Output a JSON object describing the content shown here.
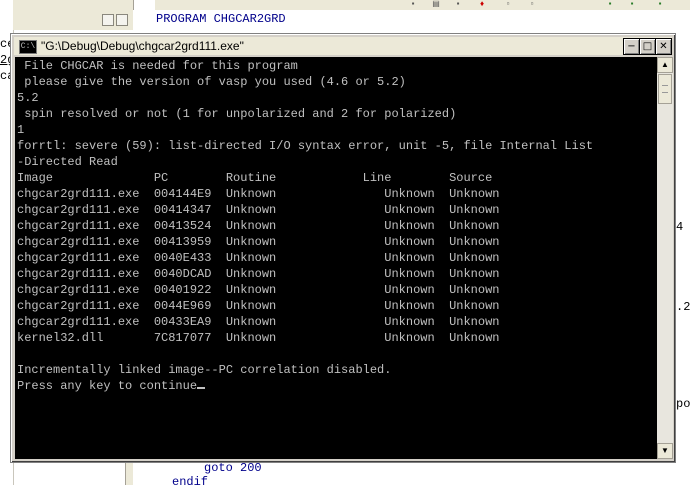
{
  "background_editor": {
    "code_line": "PROGRAM CHGCAR2GRD",
    "left_fragments": [
      "ce",
      "2g",
      "ca"
    ],
    "right_fragments": [
      "4",
      ".2",
      "po"
    ],
    "bottom_lines": [
      "goto 200",
      "endif"
    ]
  },
  "console": {
    "window_title": "\"G:\\Debug\\Debug\\chgcar2grd111.exe\"",
    "icon": "console-icon",
    "buttons": {
      "minimize": "−",
      "maximize": "□",
      "close": "✕"
    },
    "lines": [
      " File CHGCAR is needed for this program",
      " please give the version of vasp you used (4.6 or 5.2)",
      "5.2",
      " spin resolved or not (1 for unpolarized and 2 for polarized)",
      "1",
      "forrtl: severe (59): list-directed I/O syntax error, unit -5, file Internal List",
      "-Directed Read",
      "Image              PC        Routine            Line        Source",
      "chgcar2grd111.exe  004144E9  Unknown               Unknown  Unknown",
      "chgcar2grd111.exe  00414347  Unknown               Unknown  Unknown",
      "chgcar2grd111.exe  00413524  Unknown               Unknown  Unknown",
      "chgcar2grd111.exe  00413959  Unknown               Unknown  Unknown",
      "chgcar2grd111.exe  0040E433  Unknown               Unknown  Unknown",
      "chgcar2grd111.exe  0040DCAD  Unknown               Unknown  Unknown",
      "chgcar2grd111.exe  00401922  Unknown               Unknown  Unknown",
      "chgcar2grd111.exe  0044E969  Unknown               Unknown  Unknown",
      "chgcar2grd111.exe  00433EA9  Unknown               Unknown  Unknown",
      "kernel32.dll       7C817077  Unknown               Unknown  Unknown",
      "",
      "Incrementally linked image--PC correlation disabled.",
      "Press any key to continue"
    ],
    "colors": {
      "background": "#000000",
      "text": "#c0c0c0"
    }
  }
}
